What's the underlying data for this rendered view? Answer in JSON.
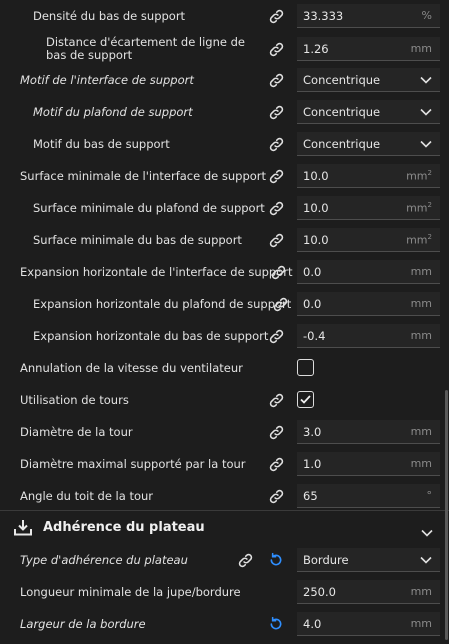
{
  "settings": {
    "support_bottom_density": {
      "label": "Densité du bas de support",
      "value": "33.333",
      "unit": "%"
    },
    "support_bottom_line_distance": {
      "label": "Distance d'écartement de ligne de bas de support",
      "value": "1.26",
      "unit": "mm"
    },
    "support_interface_pattern": {
      "label": "Motif de l'interface de support",
      "value": "Concentrique"
    },
    "support_roof_pattern": {
      "label": "Motif du plafond de support",
      "value": "Concentrique"
    },
    "support_bottom_pattern": {
      "label": "Motif du bas de support",
      "value": "Concentrique"
    },
    "min_interface_area": {
      "label": "Surface minimale de l'interface de support",
      "value": "10.0",
      "unit": "mm",
      "unit_sup": "2"
    },
    "min_roof_area": {
      "label": "Surface minimale du plafond de support",
      "value": "10.0",
      "unit": "mm",
      "unit_sup": "2"
    },
    "min_bottom_area": {
      "label": "Surface minimale du bas de support",
      "value": "10.0",
      "unit": "mm",
      "unit_sup": "2"
    },
    "interface_offset": {
      "label": "Expansion horizontale de l'interface de support",
      "value": "0.0",
      "unit": "mm"
    },
    "roof_offset": {
      "label": "Expansion horizontale du plafond de support",
      "value": "0.0",
      "unit": "mm"
    },
    "bottom_offset": {
      "label": "Expansion horizontale du bas de support",
      "value": "-0.4",
      "unit": "mm"
    },
    "fan_speed_override": {
      "label": "Annulation de la vitesse du ventilateur",
      "checked": false
    },
    "use_towers": {
      "label": "Utilisation de tours",
      "checked": true
    },
    "tower_diameter": {
      "label": "Diamètre de la tour",
      "value": "3.0",
      "unit": "mm"
    },
    "tower_max_supported_diameter": {
      "label": "Diamètre maximal supporté par la tour",
      "value": "1.0",
      "unit": "mm"
    },
    "tower_roof_angle": {
      "label": "Angle du toit de la tour",
      "value": "65",
      "unit": "°"
    }
  },
  "section": {
    "title": "Adhérence du plateau"
  },
  "adhesion": {
    "adhesion_type": {
      "label": "Type d'adhérence du plateau",
      "value": "Bordure"
    },
    "skirt_brim_min_length": {
      "label": "Longueur minimale de la jupe/bordure",
      "value": "250.0",
      "unit": "mm"
    },
    "brim_width": {
      "label": "Largeur de la bordure",
      "value": "4.0",
      "unit": "mm"
    }
  },
  "colors": {
    "background": "#1d1d1d",
    "field": "#252525",
    "accent_reset": "#2f8fff"
  },
  "icons": {
    "link": "link-icon",
    "reset": "reset-icon",
    "dropdown": "chevron-down-icon",
    "section": "download-tray-icon"
  }
}
